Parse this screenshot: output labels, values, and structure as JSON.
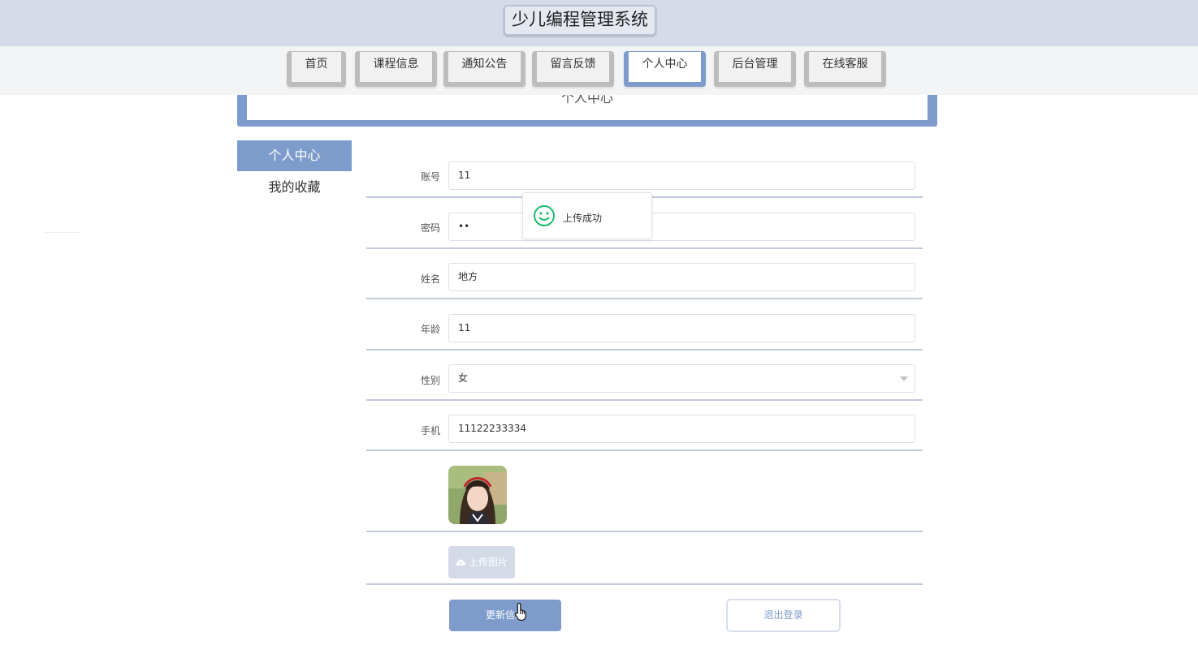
{
  "header": {
    "title": "少儿编程管理系统"
  },
  "nav": {
    "items": [
      {
        "label": "首页"
      },
      {
        "label": "课程信息"
      },
      {
        "label": "通知公告"
      },
      {
        "label": "留言反馈"
      },
      {
        "label": "个人中心"
      },
      {
        "label": "后台管理"
      },
      {
        "label": "在线客服"
      }
    ],
    "active": "个人中心"
  },
  "banner": {
    "title": "个人中心"
  },
  "sidebar": {
    "items": [
      {
        "label": "个人中心"
      },
      {
        "label": "我的收藏"
      }
    ]
  },
  "form": {
    "fields": [
      {
        "label": "账号",
        "value": "11"
      },
      {
        "label": "密码",
        "value": "••"
      },
      {
        "label": "姓名",
        "value": "地方"
      },
      {
        "label": "年龄",
        "value": "11"
      },
      {
        "label": "性别",
        "value": "女"
      },
      {
        "label": "手机",
        "value": "11122233334"
      }
    ],
    "upload_label": "上传图片",
    "update_label": "更新信息",
    "logout_label": "退出登录"
  },
  "toast": {
    "message": "上传成功"
  },
  "colors": {
    "accent": "#7e9ccb",
    "header_bg": "#d5dce8",
    "success_icon": "#19be6b"
  },
  "icons": {
    "toast": "smile-icon",
    "upload": "cloud-upload-icon",
    "select": "caret-down-icon",
    "cursor": "hand-pointer-icon"
  }
}
